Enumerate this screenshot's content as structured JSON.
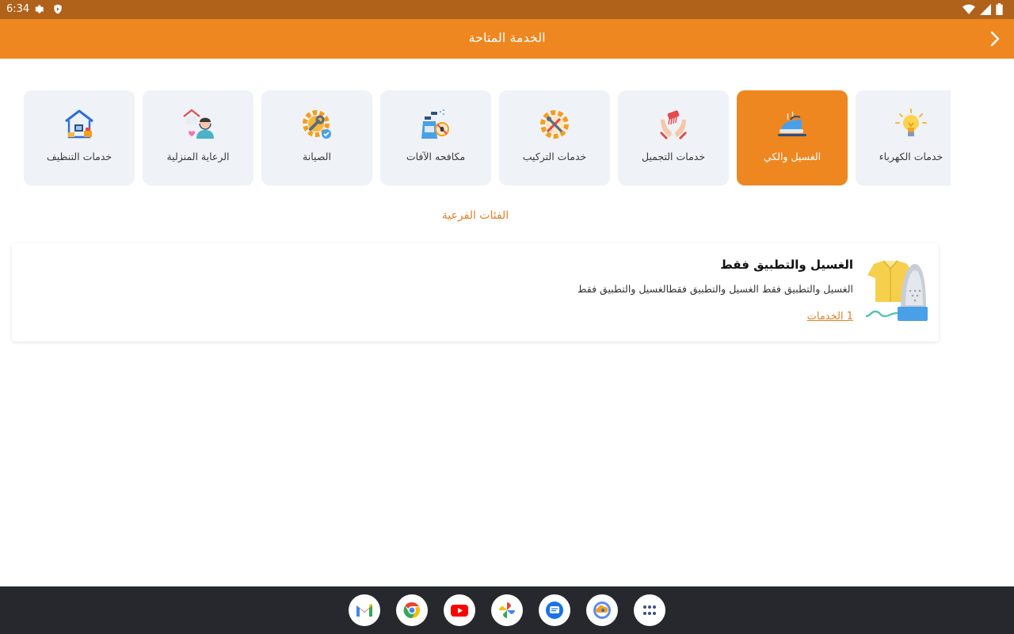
{
  "status_bar": {
    "time": "6:34"
  },
  "header": {
    "title": "الخدمة المتاحة"
  },
  "categories": [
    {
      "label": "خدمات الكهرباء",
      "icon": "lightbulb-icon",
      "active": false
    },
    {
      "label": "الغسيل والكي",
      "icon": "iron-icon",
      "active": true
    },
    {
      "label": "خدمات التجميل",
      "icon": "beauty-hands-icon",
      "active": false
    },
    {
      "label": "خدمات التركيب",
      "icon": "tools-gear-icon",
      "active": false
    },
    {
      "label": "مكافحه الآفات",
      "icon": "pest-spray-icon",
      "active": false
    },
    {
      "label": "الصيانة",
      "icon": "maintenance-gear-icon",
      "active": false
    },
    {
      "label": "الرعاية المنزلية",
      "icon": "home-care-icon",
      "active": false
    },
    {
      "label": "خدمات التنظيف",
      "icon": "house-cleaning-icon",
      "active": false
    }
  ],
  "subcategories_title": "الفئات الفرعية",
  "subcategory": {
    "name": "الغسيل والتطبيق فقط",
    "description": "الغسيل والتطبيق فقط الغسيل والتطبيق فقطالغسيل والتطبيق فقط",
    "services_link": "1 الخدمات",
    "image": "shirt-and-iron-icon"
  },
  "dock": [
    {
      "name": "Gmail",
      "icon": "gmail-icon"
    },
    {
      "name": "Chrome",
      "icon": "chrome-icon"
    },
    {
      "name": "YouTube",
      "icon": "youtube-icon"
    },
    {
      "name": "Photos",
      "icon": "photos-icon"
    },
    {
      "name": "Messages",
      "icon": "messages-icon"
    },
    {
      "name": "Cloud app",
      "icon": "cloud-app-icon"
    },
    {
      "name": "App launcher",
      "icon": "launcher-icon"
    }
  ],
  "colors": {
    "accent": "#ee871f",
    "status_bar": "#b0611a",
    "card_bg": "#eff2f7",
    "dock_bg": "#26282d"
  }
}
